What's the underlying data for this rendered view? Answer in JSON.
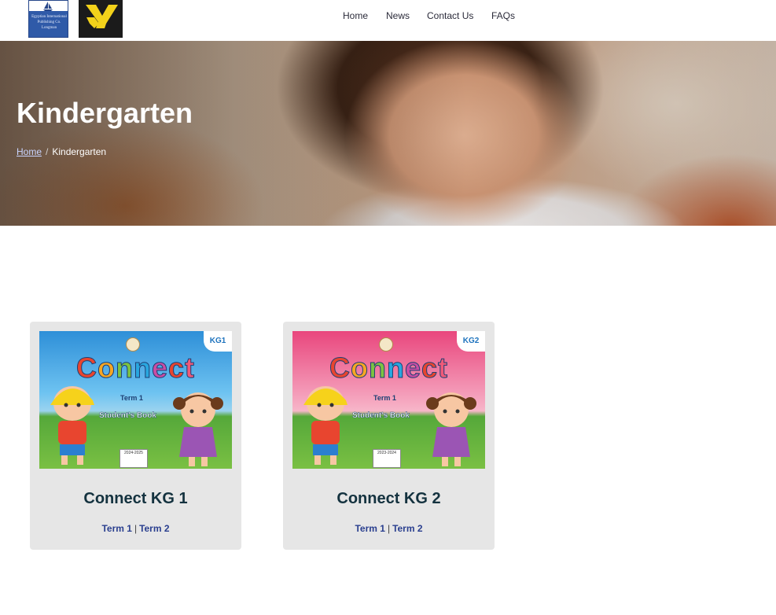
{
  "header": {
    "logos": [
      {
        "name": "eip-longman-logo",
        "lines": [
          "Egyptian International",
          "Publishing Co.",
          "Longman"
        ]
      },
      {
        "name": "y-logo",
        "letter": "Y",
        "bg": "#1b1b1b",
        "color": "#f3d21a"
      }
    ],
    "nav": [
      {
        "label": "Home"
      },
      {
        "label": "News"
      },
      {
        "label": "Contact Us"
      },
      {
        "label": "FAQs"
      }
    ]
  },
  "hero": {
    "title": "Kindergarten",
    "breadcrumb": {
      "home": "Home",
      "separator": "/",
      "current": "Kindergarten"
    }
  },
  "cards": [
    {
      "title": "Connect KG 1",
      "cover": {
        "badge": "KG1",
        "brand": "Connect",
        "term": "Term 1",
        "book": "Student's Book",
        "year": "2024-2025",
        "accent": "#2e8fd8"
      },
      "terms": [
        "Term 1",
        "Term 2"
      ],
      "separator": "|"
    },
    {
      "title": "Connect KG 2",
      "cover": {
        "badge": "KG2",
        "brand": "Connect",
        "term": "Term 1",
        "book": "Student's Book",
        "year": "2023-2024",
        "accent": "#e9467d"
      },
      "terms": [
        "Term 1",
        "Term 2"
      ],
      "separator": "|"
    }
  ],
  "colors": {
    "link": "#2a3f8f",
    "title": "#14323f",
    "card_bg": "#e6e6e6"
  }
}
